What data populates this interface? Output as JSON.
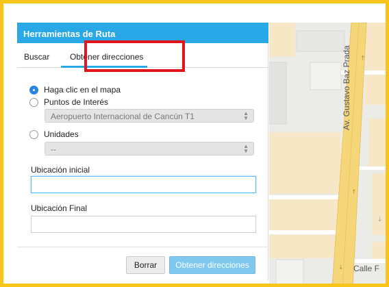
{
  "panel": {
    "title": "Herramientas de Ruta",
    "tabs": [
      {
        "label": "Buscar",
        "active": false
      },
      {
        "label": "Obtener direcciones",
        "active": true
      }
    ],
    "options": [
      {
        "label": "Haga clic en el mapa",
        "checked": true
      },
      {
        "label": "Puntos de Interés",
        "checked": false
      },
      {
        "label": "Unidades",
        "checked": false
      }
    ],
    "poi_select": {
      "value": "Aeropuerto Internacional de Cancún T1"
    },
    "unit_select": {
      "value": "--"
    },
    "start_field": {
      "label": "Ubicación inicial",
      "value": ""
    },
    "end_field": {
      "label": "Ubicación Final",
      "value": ""
    },
    "buttons": {
      "clear": "Borrar",
      "submit": "Obtener direcciones"
    }
  },
  "map": {
    "street_main": "Av. Gustavo Baz Prada",
    "street_bottom": "Calle F"
  },
  "colors": {
    "frame": "#f7c41c",
    "header": "#29a8e8",
    "highlight": "#e3131b",
    "road": "#f5d77a"
  }
}
